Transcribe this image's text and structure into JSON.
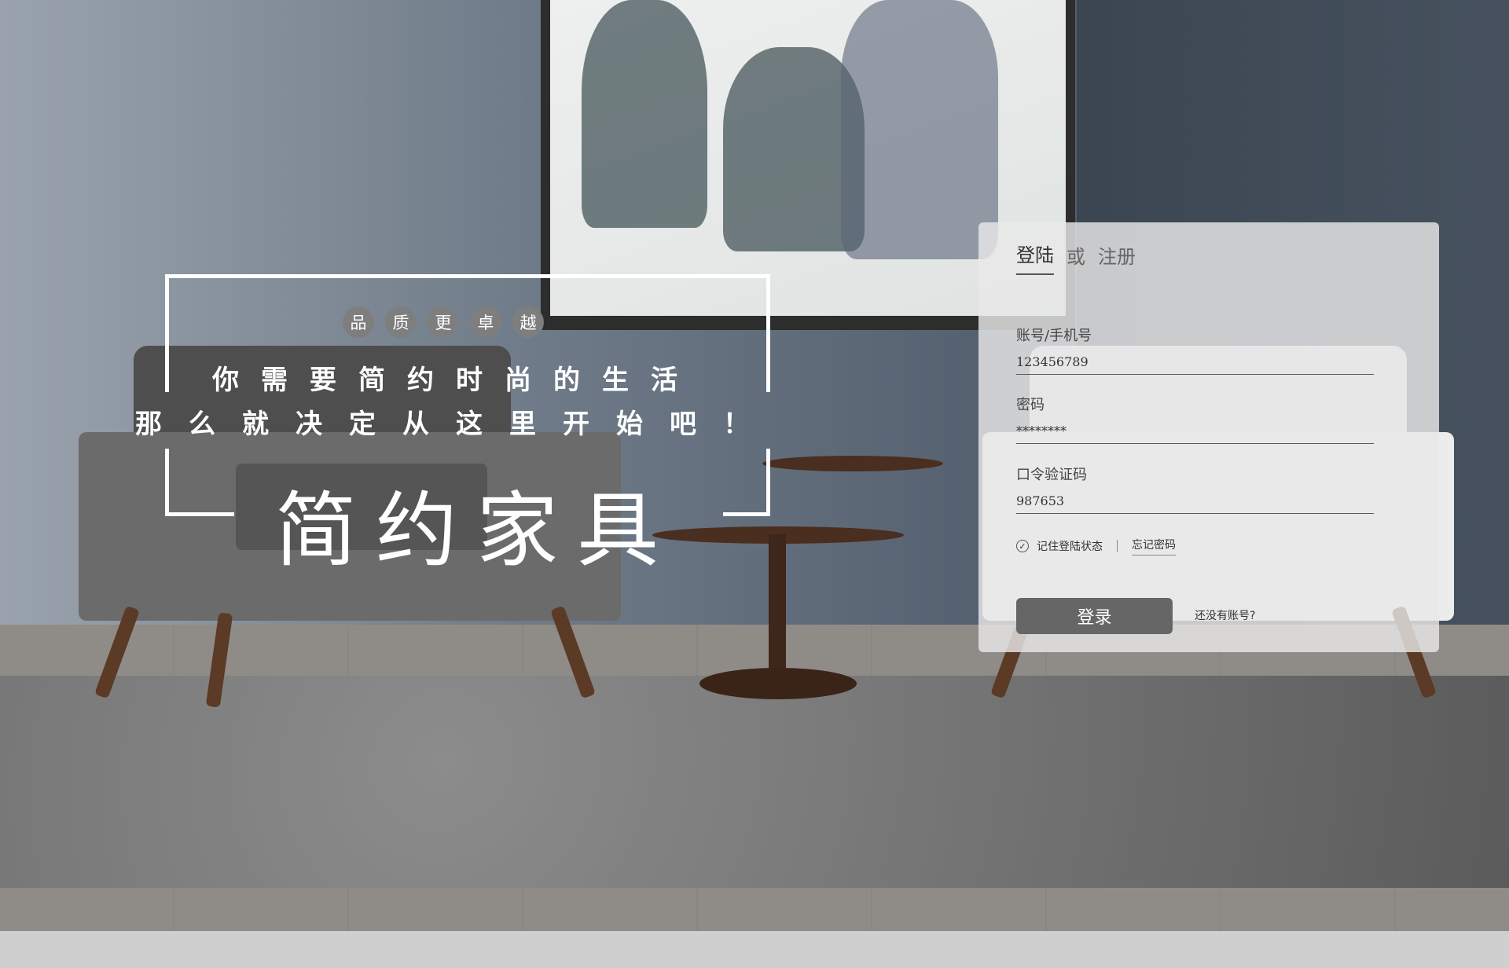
{
  "hero": {
    "quality_chars": [
      "品",
      "质",
      "更",
      "卓",
      "越"
    ],
    "slogan_line1": "你需要简约时尚的生活",
    "slogan_line2": "那么就决定从这里开始吧！",
    "brand_title": "简约家具"
  },
  "login": {
    "tab_login": "登陆",
    "tab_separator": "或",
    "tab_register": "注册",
    "account_label": "账号/手机号",
    "account_value": "123456789",
    "password_label": "密码",
    "password_value": "********",
    "code_label": "口令验证码",
    "code_value": "987653",
    "remember_label": "记住登陆状态",
    "forgot_label": "忘记密码",
    "login_button": "登录",
    "no_account_link": "还没有账号?"
  },
  "icons": {
    "remember_check": "check-icon"
  },
  "colors": {
    "panel_bg": "#e8e8e8",
    "button_bg": "#666666",
    "hero_text": "#ffffff"
  }
}
